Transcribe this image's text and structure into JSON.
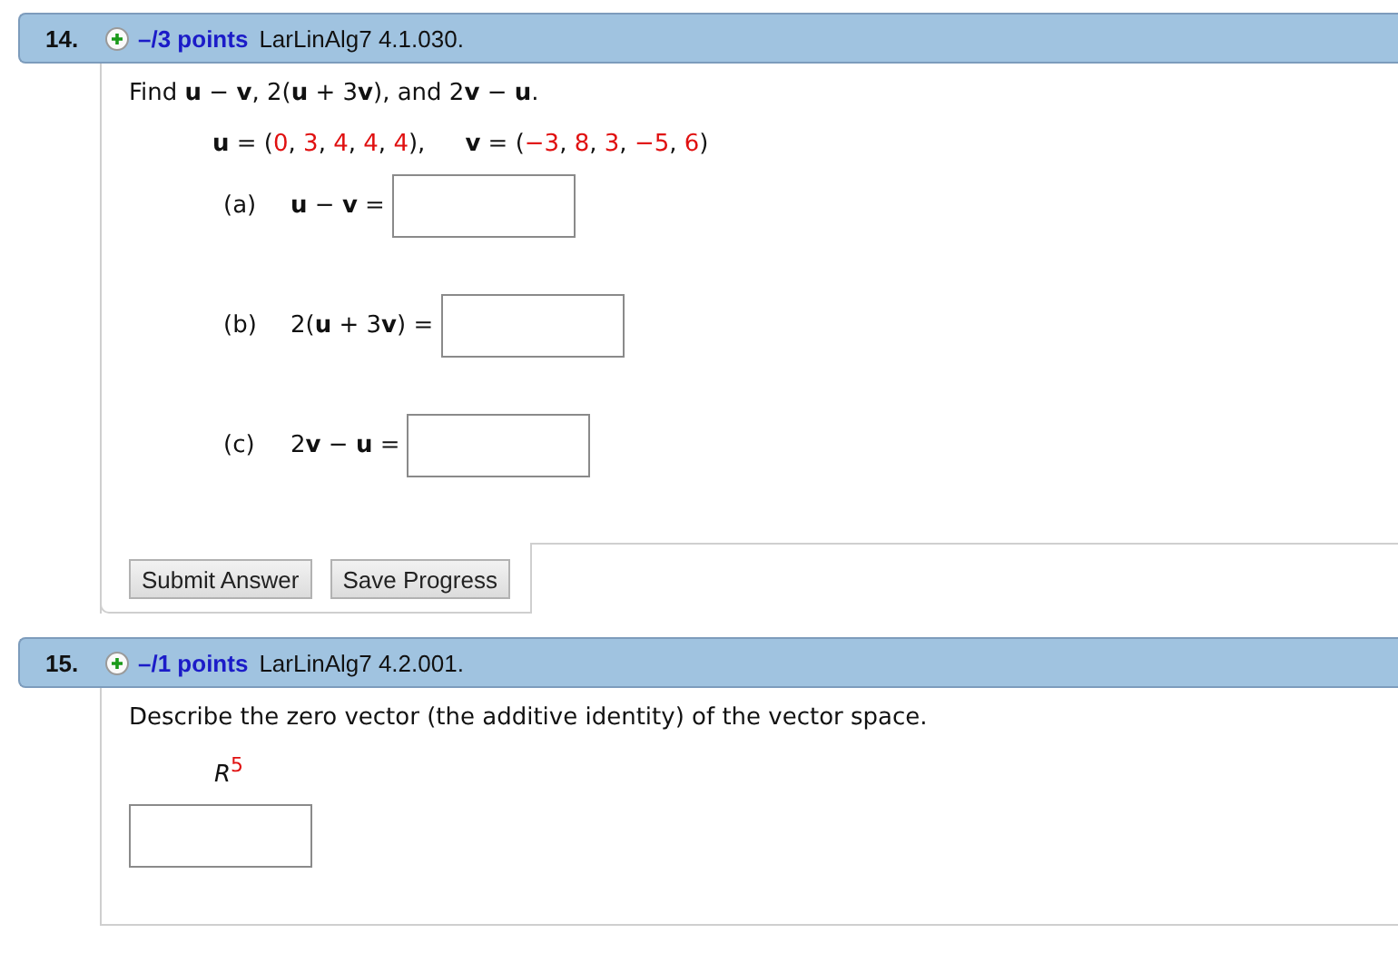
{
  "questions": [
    {
      "number": "14.",
      "points": "–/3 points",
      "reference": "LarLinAlg7 4.1.030.",
      "prompt": "Find **u** − **v**, 2(**u** + 3**v**), and 2**v** − **u**.",
      "vectors": [
        {
          "segments": [
            {
              "kind": "bold",
              "text": "u"
            },
            {
              "kind": "plain",
              "text": " = ("
            },
            {
              "kind": "value",
              "text": "0"
            },
            {
              "kind": "plain",
              "text": ", "
            },
            {
              "kind": "value",
              "text": "3"
            },
            {
              "kind": "plain",
              "text": ", "
            },
            {
              "kind": "value",
              "text": "4"
            },
            {
              "kind": "plain",
              "text": ", "
            },
            {
              "kind": "value",
              "text": "4"
            },
            {
              "kind": "plain",
              "text": ", "
            },
            {
              "kind": "value",
              "text": "4"
            },
            {
              "kind": "plain",
              "text": "),"
            }
          ]
        },
        {
          "segments": [
            {
              "kind": "bold",
              "text": "v"
            },
            {
              "kind": "plain",
              "text": " = ("
            },
            {
              "kind": "value",
              "text": "−3"
            },
            {
              "kind": "plain",
              "text": ", "
            },
            {
              "kind": "value",
              "text": "8"
            },
            {
              "kind": "plain",
              "text": ", "
            },
            {
              "kind": "value",
              "text": "3"
            },
            {
              "kind": "plain",
              "text": ", "
            },
            {
              "kind": "value",
              "text": "−5"
            },
            {
              "kind": "plain",
              "text": ", "
            },
            {
              "kind": "value",
              "text": "6"
            },
            {
              "kind": "plain",
              "text": ")"
            }
          ]
        }
      ],
      "parts": [
        {
          "label": "(a)",
          "expression": "**u** − **v** ="
        },
        {
          "label": "(b)",
          "expression": "2(**u** + 3**v**) ="
        },
        {
          "label": "(c)",
          "expression": "2**v** − **u** ="
        }
      ],
      "buttons": [
        "Submit Answer",
        "Save Progress"
      ]
    },
    {
      "number": "15.",
      "points": "–/1 points",
      "reference": "LarLinAlg7 4.2.001.",
      "prompt": "Describe the zero vector (the additive identity) of the vector space.",
      "space": "*R*$^{5}$",
      "answer": {
        "kind": "input"
      }
    }
  ]
}
